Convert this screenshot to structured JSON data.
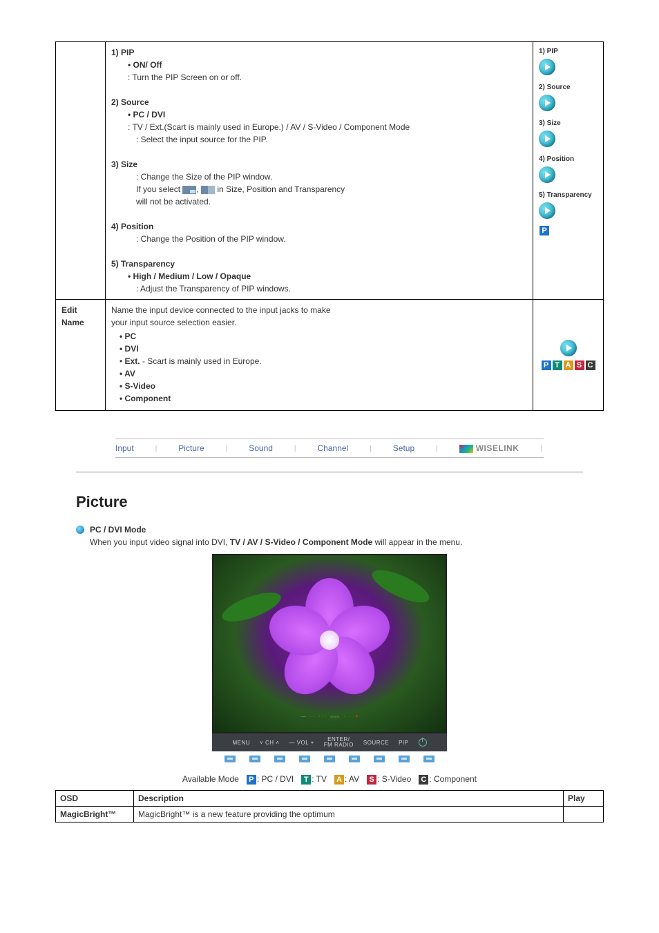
{
  "pip_table": {
    "row1": {
      "pip": {
        "num": "1) PIP",
        "opt": "• ON/ Off",
        "desc": ": Turn the PIP Screen on or off."
      },
      "source": {
        "num": "2) Source",
        "opt": "• PC / DVI",
        "desc1": ": TV / Ext.(Scart is mainly used in Europe.) / AV / S-Video / Component Mode",
        "desc2": ": Select the input source for the PIP."
      },
      "size": {
        "num": "3) Size",
        "desc1": ": Change the Size of the PIP window.",
        "desc2_pre": "If you select ",
        "desc2_post": " in Size, Position and Transparency",
        "desc3": "will not be activated."
      },
      "position": {
        "num": "4) Position",
        "desc": ": Change the Position of the PIP window."
      },
      "transparency": {
        "num": "5) Transparency",
        "opt": "• High / Medium / Low / Opaque",
        "desc": ": Adjust the Transparency of PIP windows."
      },
      "side": {
        "s1": "1) PIP",
        "s2": "2) Source",
        "s3": "3) Size",
        "s4": "4) Position",
        "s5": "5) Transparency"
      }
    },
    "row2": {
      "label_l1": "Edit",
      "label_l2": "Name",
      "desc_l1": "Name the input device connected to the input jacks to make",
      "desc_l2": "your input source selection easier.",
      "items": {
        "i1": "PC",
        "i2": "DVI",
        "i3_b": "Ext.",
        "i3_r": " - Scart is mainly used in Europe.",
        "i4": "AV",
        "i5": "S-Video",
        "i6": "Component"
      }
    }
  },
  "tabs": {
    "t1": "Input",
    "t2": "Picture",
    "t3": "Sound",
    "t4": "Channel",
    "t5": "Setup",
    "t6": "WISELINK"
  },
  "picture": {
    "title": "Picture",
    "mode_label": "PC / DVI Mode",
    "mode_desc_pre": "When you input video signal into DVI, ",
    "mode_desc_bold": "TV / AV / S-Video / Component Mode",
    "mode_desc_post": " will appear in the menu.",
    "bezel": {
      "b1": "MENU",
      "b2": "CH",
      "b3": "VOL",
      "b4": "ENTER/\nFM RADIO",
      "b5": "SOURCE",
      "b6": "PIP"
    },
    "avail_label": "Available Mode",
    "avail": {
      "p": ": PC / DVI",
      "t": ": TV",
      "a": ": AV",
      "s": ": S-Video",
      "c": ": Component"
    },
    "osd_table": {
      "h1": "OSD",
      "h2": "Description",
      "h3": "Play",
      "r1_c1": "MagicBright™",
      "r1_c2": "MagicBright™ is a new feature providing the optimum"
    }
  }
}
